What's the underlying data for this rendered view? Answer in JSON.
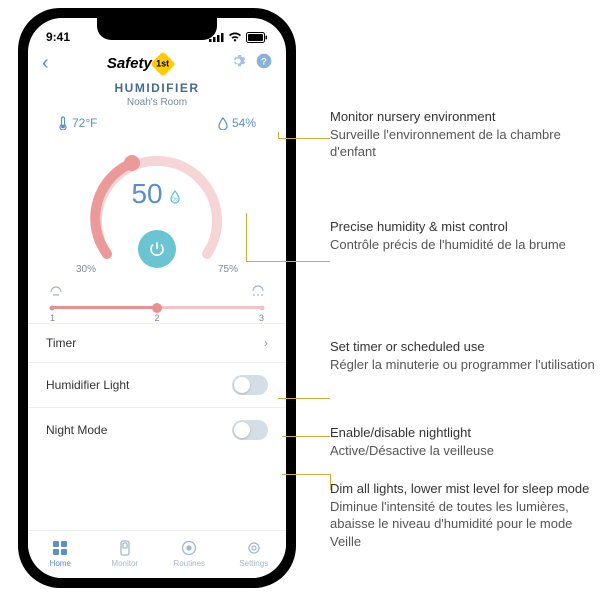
{
  "status": {
    "time": "9:41"
  },
  "header": {
    "brand": "Safety",
    "brand_suffix": "1st"
  },
  "title": {
    "main": "HUMIDIFIER",
    "sub": "Noah's Room"
  },
  "env": {
    "temp": "72°F",
    "humidity": "54%"
  },
  "gauge": {
    "value": "50",
    "low": "30%",
    "high": "75%"
  },
  "mist": {
    "levels": [
      "1",
      "2",
      "3"
    ]
  },
  "rows": {
    "timer": "Timer",
    "light": "Humidifier Light",
    "night": "Night Mode"
  },
  "nav": {
    "home": "Home",
    "monitor": "Monitor",
    "routines": "Routines",
    "settings": "Settings"
  },
  "callouts": {
    "c1_en": "Monitor nursery environment",
    "c1_fr": "Surveille l'environnement de la chambre d'enfant",
    "c2_en": "Precise humidity & mist control",
    "c2_fr": "Contrôle précis de l'humidité de la brume",
    "c3_en": "Set timer or scheduled use",
    "c3_fr": "Régler la minuterie ou programmer l'utilisation",
    "c4_en": "Enable/disable nightlight",
    "c4_fr": "Active/Désactive la veilleuse",
    "c5_en": "Dim all lights, lower mist level for sleep mode",
    "c5_fr": "Diminue l'intensité de toutes les lumières, abaisse le niveau d'humidité pour le mode Veille"
  }
}
